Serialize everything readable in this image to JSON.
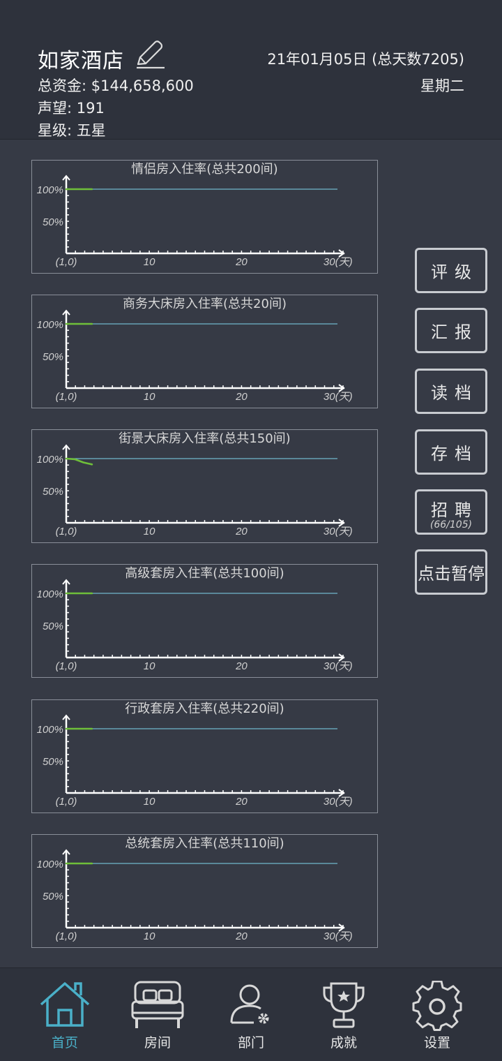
{
  "header": {
    "hotel_name": "如家酒店",
    "funds": "总资金: $144,658,600",
    "reputation": "声望: 191",
    "star_level": "星级: 五星",
    "date": "21年01月05日 (总天数7205)",
    "weekday": "星期二"
  },
  "colors": {
    "background": "#363a45",
    "header": "#2e323c",
    "target_line": "#6fb6cc",
    "occupancy_line": "#6fbf3a",
    "active_nav": "#4ab0c8"
  },
  "charts": [
    {
      "title": "情侣房入住率(总共200间)"
    },
    {
      "title": "商务大床房入住率(总共20间)"
    },
    {
      "title": "街景大床房入住率(总共150间)"
    },
    {
      "title": "高级套房入住率(总共100间)"
    },
    {
      "title": "行政套房入住率(总共220间)"
    },
    {
      "title": "总统套房入住率(总共110间)"
    }
  ],
  "chart_data": [
    {
      "type": "line",
      "title": "情侣房入住率(总共200间)",
      "xlabel": "(天)",
      "x_ticks": [
        "(1,0)",
        "10",
        "20",
        "30(天)"
      ],
      "y_ticks": [
        "100%",
        "50%"
      ],
      "xlim": [
        1,
        31
      ],
      "ylim": [
        0,
        100
      ],
      "series": [
        {
          "x": [
            1,
            2,
            3,
            4
          ],
          "values": [
            100,
            100,
            100,
            100
          ]
        }
      ],
      "target": 100
    },
    {
      "type": "line",
      "title": "商务大床房入住率(总共20间)",
      "xlabel": "(天)",
      "x_ticks": [
        "(1,0)",
        "10",
        "20",
        "30(天)"
      ],
      "y_ticks": [
        "100%",
        "50%"
      ],
      "xlim": [
        1,
        31
      ],
      "ylim": [
        0,
        100
      ],
      "series": [
        {
          "x": [
            1,
            2,
            3,
            4
          ],
          "values": [
            100,
            100,
            100,
            100
          ]
        }
      ],
      "target": 100
    },
    {
      "type": "line",
      "title": "街景大床房入住率(总共150间)",
      "xlabel": "(天)",
      "x_ticks": [
        "(1,0)",
        "10",
        "20",
        "30(天)"
      ],
      "y_ticks": [
        "100%",
        "50%"
      ],
      "xlim": [
        1,
        31
      ],
      "ylim": [
        0,
        100
      ],
      "series": [
        {
          "x": [
            1,
            2,
            3,
            4
          ],
          "values": [
            100,
            99,
            94,
            91
          ]
        }
      ],
      "target": 100
    },
    {
      "type": "line",
      "title": "高级套房入住率(总共100间)",
      "xlabel": "(天)",
      "x_ticks": [
        "(1,0)",
        "10",
        "20",
        "30(天)"
      ],
      "y_ticks": [
        "100%",
        "50%"
      ],
      "xlim": [
        1,
        31
      ],
      "ylim": [
        0,
        100
      ],
      "series": [
        {
          "x": [
            1,
            2,
            3,
            4
          ],
          "values": [
            100,
            100,
            100,
            100
          ]
        }
      ],
      "target": 100
    },
    {
      "type": "line",
      "title": "行政套房入住率(总共220间)",
      "xlabel": "(天)",
      "x_ticks": [
        "(1,0)",
        "10",
        "20",
        "30(天)"
      ],
      "y_ticks": [
        "100%",
        "50%"
      ],
      "xlim": [
        1,
        31
      ],
      "ylim": [
        0,
        100
      ],
      "series": [
        {
          "x": [
            1,
            2,
            3,
            4
          ],
          "values": [
            100,
            100,
            100,
            100
          ]
        }
      ],
      "target": 100
    },
    {
      "type": "line",
      "title": "总统套房入住率(总共110间)",
      "xlabel": "(天)",
      "x_ticks": [
        "(1,0)",
        "10",
        "20",
        "30(天)"
      ],
      "y_ticks": [
        "100%",
        "50%"
      ],
      "xlim": [
        1,
        31
      ],
      "ylim": [
        0,
        100
      ],
      "series": [
        {
          "x": [
            1,
            2,
            3,
            4
          ],
          "values": [
            100,
            100,
            100,
            100
          ]
        }
      ],
      "target": 100
    }
  ],
  "side_buttons": {
    "rating": "评级",
    "report": "汇报",
    "load": "读档",
    "save": "存档",
    "recruit": "招聘",
    "recruit_count": "(66/105)",
    "pause": "点击暂停"
  },
  "nav": {
    "home": "首页",
    "rooms": "房间",
    "departments": "部门",
    "achievements": "成就",
    "settings": "设置"
  }
}
